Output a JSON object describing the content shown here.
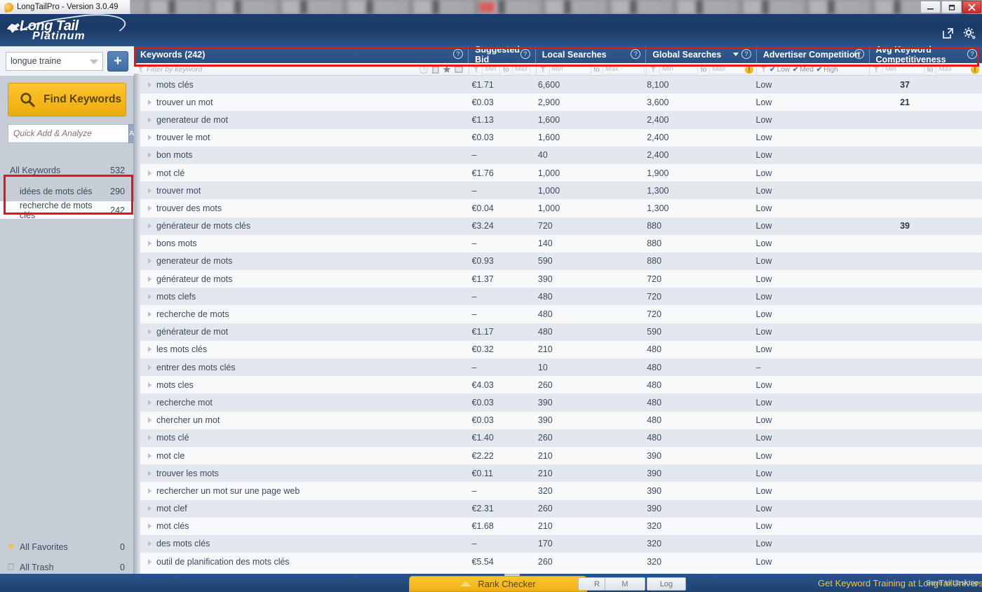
{
  "window": {
    "title": "LongTailPro - Version 3.0.49",
    "app_icon": "lizard-icon",
    "minimize_label": "—",
    "maximize_label": "❐",
    "close_label": "✕"
  },
  "header": {
    "logo_line1": "Long Tail",
    "logo_line2": "Platinum",
    "export_icon": "external-link-icon",
    "settings_icon": "gear-icon"
  },
  "sidebar": {
    "project_select": {
      "value": "longue traine",
      "add_label": "+"
    },
    "find_keywords_label": "Find Keywords",
    "quick_add": {
      "placeholder": "Quick Add & Analyze",
      "button_label": "Add"
    },
    "all_keywords": {
      "label": "All Keywords",
      "count": "532"
    },
    "groups": [
      {
        "label": "idées de mots clés",
        "count": "290",
        "selected": false
      },
      {
        "label": "recherche de mots clés",
        "count": "242",
        "selected": true
      }
    ],
    "favorites": {
      "label": "All Favorites",
      "count": "0"
    },
    "trash": {
      "label": "All Trash",
      "count": "0"
    }
  },
  "table": {
    "columns": [
      {
        "label": "Keywords (242)",
        "help": "?",
        "sorted": false
      },
      {
        "label": "Suggested Bid",
        "help": "?",
        "sorted": false
      },
      {
        "label": "Local Searches",
        "help": "?",
        "sorted": false
      },
      {
        "label": "Global Searches",
        "help": "?",
        "sorted": true
      },
      {
        "label": "Advertiser Competition",
        "help": "?",
        "sorted": false
      },
      {
        "label": "Avg Keyword Competitiveness",
        "help": "?",
        "sorted": false
      }
    ],
    "filters": {
      "keyword_placeholder": "Filter by keyword",
      "min_placeholder": "Min",
      "max_placeholder": "Max",
      "to_label": "to",
      "competition_options": [
        "Low",
        "Med",
        "High"
      ],
      "warning_badge": "!"
    },
    "rows": [
      {
        "keyword": "mots clés",
        "bid": "€1.71",
        "local": "6,600",
        "global": "8,100",
        "advertiser": "Low",
        "akc": "37"
      },
      {
        "keyword": "trouver un mot",
        "bid": "€0.03",
        "local": "2,900",
        "global": "3,600",
        "advertiser": "Low",
        "akc": "21"
      },
      {
        "keyword": "generateur de mot",
        "bid": "€1.13",
        "local": "1,600",
        "global": "2,400",
        "advertiser": "Low",
        "akc": ""
      },
      {
        "keyword": "trouver le mot",
        "bid": "€0.03",
        "local": "1,600",
        "global": "2,400",
        "advertiser": "Low",
        "akc": ""
      },
      {
        "keyword": "bon mots",
        "bid": "–",
        "local": "40",
        "global": "2,400",
        "advertiser": "Low",
        "akc": ""
      },
      {
        "keyword": "mot clé",
        "bid": "€1.76",
        "local": "1,000",
        "global": "1,900",
        "advertiser": "Low",
        "akc": ""
      },
      {
        "keyword": "trouver mot",
        "bid": "–",
        "local": "1,000",
        "global": "1,300",
        "advertiser": "Low",
        "akc": ""
      },
      {
        "keyword": "trouver des mots",
        "bid": "€0.04",
        "local": "1,000",
        "global": "1,300",
        "advertiser": "Low",
        "akc": ""
      },
      {
        "keyword": "générateur de mots clés",
        "bid": "€3.24",
        "local": "720",
        "global": "880",
        "advertiser": "Low",
        "akc": "39"
      },
      {
        "keyword": "bons mots",
        "bid": "–",
        "local": "140",
        "global": "880",
        "advertiser": "Low",
        "akc": ""
      },
      {
        "keyword": "generateur de mots",
        "bid": "€0.93",
        "local": "590",
        "global": "880",
        "advertiser": "Low",
        "akc": ""
      },
      {
        "keyword": "générateur de mots",
        "bid": "€1.37",
        "local": "390",
        "global": "720",
        "advertiser": "Low",
        "akc": ""
      },
      {
        "keyword": "mots clefs",
        "bid": "–",
        "local": "480",
        "global": "720",
        "advertiser": "Low",
        "akc": ""
      },
      {
        "keyword": "recherche de mots",
        "bid": "–",
        "local": "480",
        "global": "720",
        "advertiser": "Low",
        "akc": ""
      },
      {
        "keyword": "générateur de mot",
        "bid": "€1.17",
        "local": "480",
        "global": "590",
        "advertiser": "Low",
        "akc": ""
      },
      {
        "keyword": "les mots clés",
        "bid": "€0.32",
        "local": "210",
        "global": "480",
        "advertiser": "Low",
        "akc": ""
      },
      {
        "keyword": "entrer des mots clés",
        "bid": "–",
        "local": "10",
        "global": "480",
        "advertiser": "–",
        "akc": ""
      },
      {
        "keyword": "mots cles",
        "bid": "€4.03",
        "local": "260",
        "global": "480",
        "advertiser": "Low",
        "akc": ""
      },
      {
        "keyword": "recherche mot",
        "bid": "€0.03",
        "local": "390",
        "global": "480",
        "advertiser": "Low",
        "akc": ""
      },
      {
        "keyword": "chercher un mot",
        "bid": "€0.03",
        "local": "390",
        "global": "480",
        "advertiser": "Low",
        "akc": ""
      },
      {
        "keyword": "mots clé",
        "bid": "€1.40",
        "local": "260",
        "global": "480",
        "advertiser": "Low",
        "akc": ""
      },
      {
        "keyword": "mot cle",
        "bid": "€2.22",
        "local": "210",
        "global": "390",
        "advertiser": "Low",
        "akc": ""
      },
      {
        "keyword": "trouver les mots",
        "bid": "€0.11",
        "local": "210",
        "global": "390",
        "advertiser": "Low",
        "akc": ""
      },
      {
        "keyword": "rechercher un mot sur une page web",
        "bid": "–",
        "local": "320",
        "global": "390",
        "advertiser": "Low",
        "akc": ""
      },
      {
        "keyword": "mot clef",
        "bid": "€2.31",
        "local": "260",
        "global": "390",
        "advertiser": "Low",
        "akc": ""
      },
      {
        "keyword": "mot clés",
        "bid": "€1.68",
        "local": "210",
        "global": "320",
        "advertiser": "Low",
        "akc": ""
      },
      {
        "keyword": "des mots clés",
        "bid": "–",
        "local": "170",
        "global": "320",
        "advertiser": "Low",
        "akc": ""
      },
      {
        "keyword": "outil de planification des mots clés",
        "bid": "€5.54",
        "local": "260",
        "global": "320",
        "advertiser": "Low",
        "akc": ""
      }
    ]
  },
  "bottom": {
    "rank_checker_label": "Rank Checker",
    "buttons": [
      "R",
      "M",
      "Log"
    ],
    "promo_text": "Get Keyword Training at LongTailUniversity.com",
    "save_to_desktop": "Save to desktop"
  },
  "colors": {
    "header_blue": "#2a5183",
    "accent_yellow": "#f5b81d",
    "highlight_red": "#ee1111",
    "sidebar_gray": "#c6cdd6"
  }
}
